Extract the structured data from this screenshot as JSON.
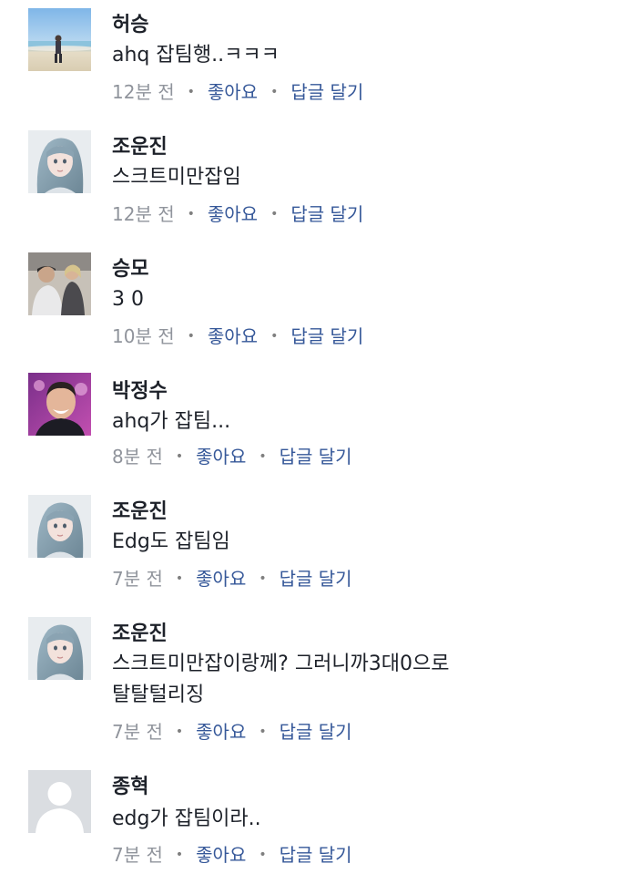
{
  "meta": {
    "separator": "•"
  },
  "comments": [
    {
      "author": "허승",
      "text_lines": [
        "ahq 잡팀행..ㅋㅋㅋ"
      ],
      "time": "12분 전",
      "like": "좋아요",
      "reply": "답글 달기",
      "avatar": "beach-photo-avatar"
    },
    {
      "author": "조운진",
      "text_lines": [
        "스크트미만잡임"
      ],
      "time": "12분 전",
      "like": "좋아요",
      "reply": "답글 달기",
      "avatar": "anime-girl-avatar"
    },
    {
      "author": "승모",
      "text_lines": [
        "3 0"
      ],
      "time": "10분 전",
      "like": "좋아요",
      "reply": "답글 달기",
      "avatar": "two-people-photo-avatar"
    },
    {
      "author": "박정수",
      "text_lines": [
        "ahq가 잡팀..."
      ],
      "time": "8분 전",
      "like": "좋아요",
      "reply": "답글 달기",
      "avatar": "smiling-man-photo-avatar"
    },
    {
      "author": "조운진",
      "text_lines": [
        "Edg도 잡팀임"
      ],
      "time": "7분 전",
      "like": "좋아요",
      "reply": "답글 달기",
      "avatar": "anime-girl-avatar"
    },
    {
      "author": "조운진",
      "text_lines": [
        "스크트미만잡이랑께? 그러니까3대0으로",
        "탈탈털리징"
      ],
      "time": "7분 전",
      "like": "좋아요",
      "reply": "답글 달기",
      "avatar": "anime-girl-avatar"
    },
    {
      "author": "종혁",
      "text_lines": [
        "edg가 잡팀이라.."
      ],
      "time": "7분 전",
      "like": "좋아요",
      "reply": "답글 달기",
      "avatar": "default-silhouette-avatar"
    }
  ]
}
